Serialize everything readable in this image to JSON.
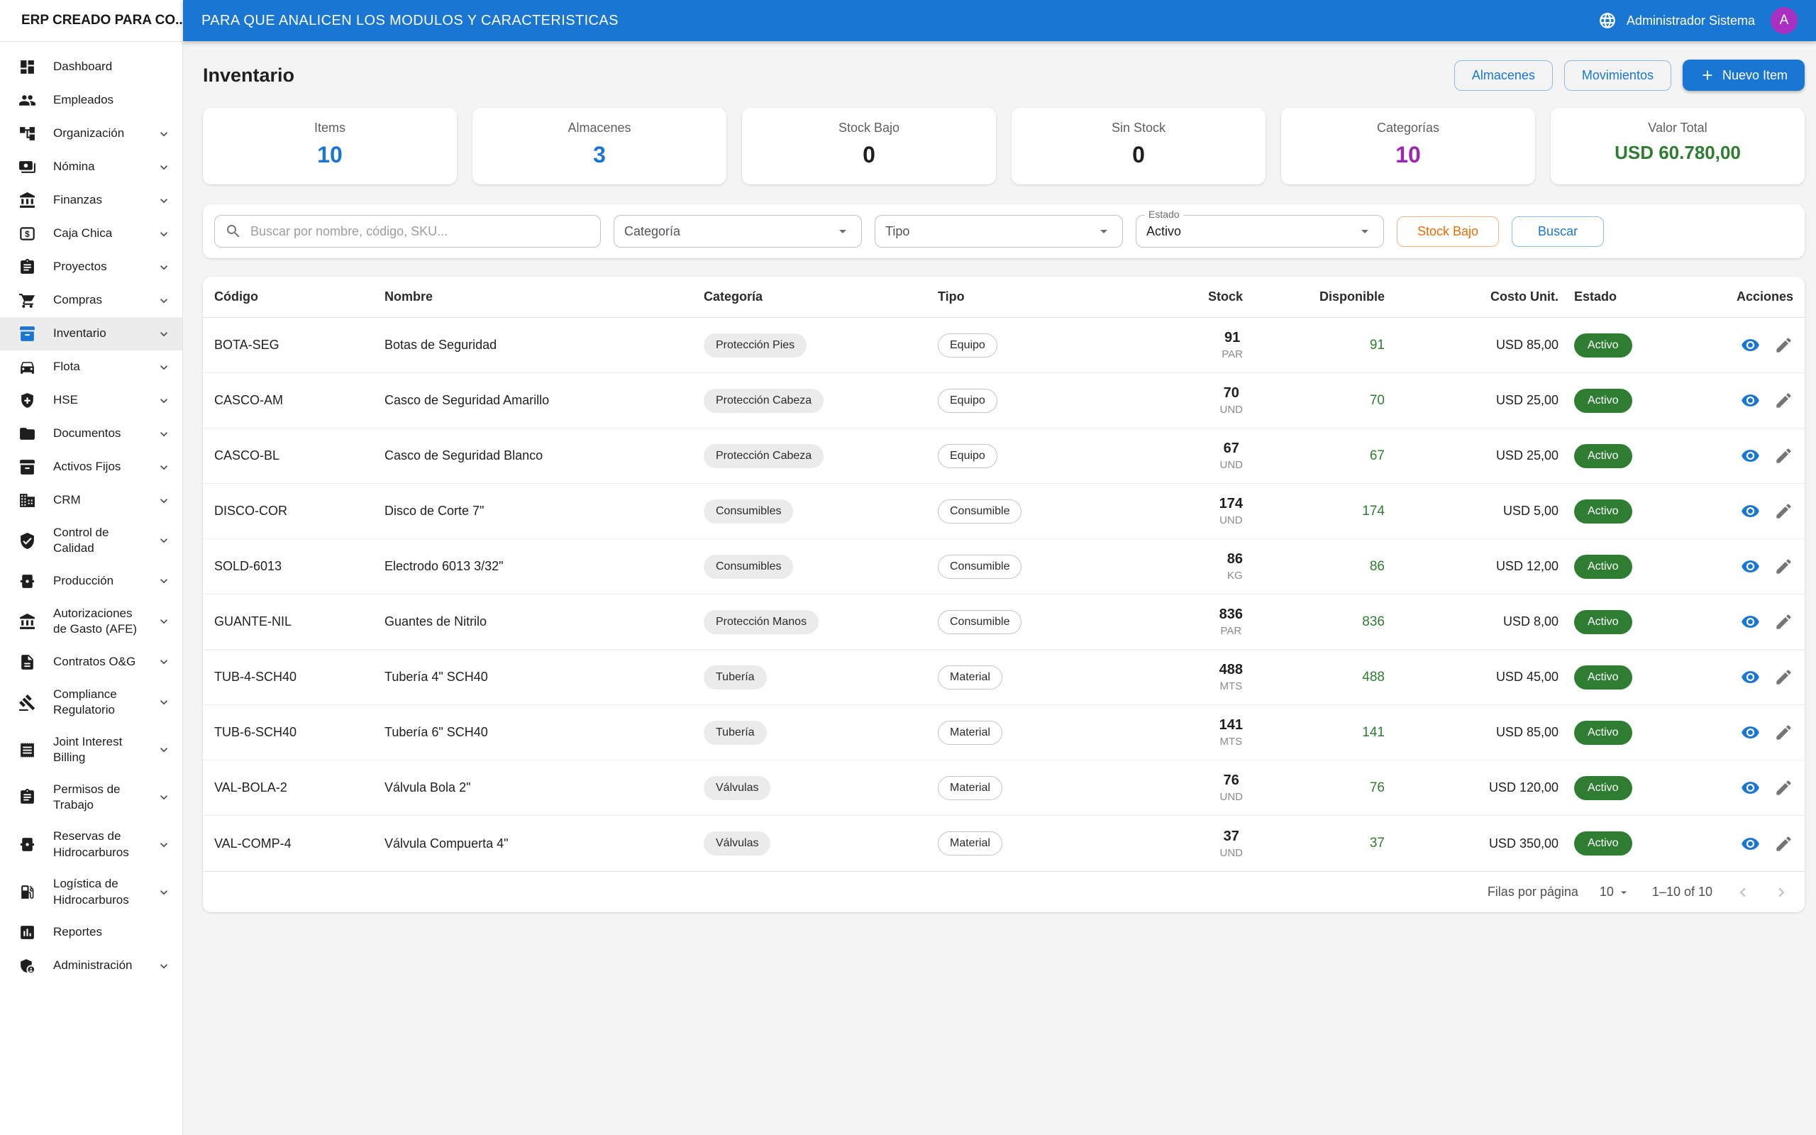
{
  "topbar": {
    "brand": "ERP CREADO PARA CO...",
    "title": "PARA QUE ANALICEN LOS MODULOS Y CARACTERISTICAS",
    "user_name": "Administrador Sistema",
    "avatar_initial": "A",
    "colors": {
      "appbar_bg": "#1976d2",
      "avatar_bg": "#a92fc1"
    }
  },
  "sidebar": {
    "items": [
      {
        "label": "Dashboard",
        "icon": "dashboard",
        "expandable": false,
        "selected": false
      },
      {
        "label": "Empleados",
        "icon": "people",
        "expandable": false,
        "selected": false
      },
      {
        "label": "Organización",
        "icon": "tree",
        "expandable": true,
        "selected": false
      },
      {
        "label": "Nómina",
        "icon": "payments",
        "expandable": true,
        "selected": false
      },
      {
        "label": "Finanzas",
        "icon": "bank",
        "expandable": true,
        "selected": false
      },
      {
        "label": "Caja Chica",
        "icon": "cashbox",
        "expandable": true,
        "selected": false
      },
      {
        "label": "Proyectos",
        "icon": "clipboard",
        "expandable": true,
        "selected": false
      },
      {
        "label": "Compras",
        "icon": "cart",
        "expandable": true,
        "selected": false
      },
      {
        "label": "Inventario",
        "icon": "inventory",
        "expandable": true,
        "selected": true
      },
      {
        "label": "Flota",
        "icon": "car",
        "expandable": true,
        "selected": false
      },
      {
        "label": "HSE",
        "icon": "shield-plus",
        "expandable": true,
        "selected": false
      },
      {
        "label": "Documentos",
        "icon": "folder",
        "expandable": true,
        "selected": false
      },
      {
        "label": "Activos Fijos",
        "icon": "inventory",
        "expandable": true,
        "selected": false
      },
      {
        "label": "CRM",
        "icon": "building",
        "expandable": true,
        "selected": false
      },
      {
        "label": "Control de Calidad",
        "icon": "shield-check",
        "expandable": true,
        "selected": false
      },
      {
        "label": "Producción",
        "icon": "barrel",
        "expandable": true,
        "selected": false
      },
      {
        "label": "Autorizaciones de Gasto (AFE)",
        "icon": "bank",
        "expandable": true,
        "selected": false
      },
      {
        "label": "Contratos O&G",
        "icon": "doc",
        "expandable": true,
        "selected": false
      },
      {
        "label": "Compliance Regulatorio",
        "icon": "gavel",
        "expandable": true,
        "selected": false
      },
      {
        "label": "Joint Interest Billing",
        "icon": "receipt",
        "expandable": true,
        "selected": false
      },
      {
        "label": "Permisos de Trabajo",
        "icon": "clipboard",
        "expandable": true,
        "selected": false
      },
      {
        "label": "Reservas de Hidrocarburos",
        "icon": "barrel",
        "expandable": true,
        "selected": false
      },
      {
        "label": "Logística de Hidrocarburos",
        "icon": "fuel",
        "expandable": true,
        "selected": false
      },
      {
        "label": "Reportes",
        "icon": "chart",
        "expandable": false,
        "selected": false
      },
      {
        "label": "Administración",
        "icon": "admin",
        "expandable": true,
        "selected": false
      }
    ]
  },
  "page": {
    "title": "Inventario",
    "almacenes_button": "Almacenes",
    "movimientos_button": "Movimientos",
    "nuevo_item_button": "Nuevo Item"
  },
  "stats": [
    {
      "label": "Items",
      "value": "10",
      "color": "#1976d2",
      "small": false
    },
    {
      "label": "Almacenes",
      "value": "3",
      "color": "#1976d2",
      "small": false
    },
    {
      "label": "Stock Bajo",
      "value": "0",
      "color": "#1f1f1f",
      "small": false
    },
    {
      "label": "Sin Stock",
      "value": "0",
      "color": "#1f1f1f",
      "small": false
    },
    {
      "label": "Categorías",
      "value": "10",
      "color": "#9c27b0",
      "small": false
    },
    {
      "label": "Valor Total",
      "value": "USD 60.780,00",
      "color": "#2e7d32",
      "small": true
    }
  ],
  "filters": {
    "search_placeholder": "Buscar por nombre, código, SKU...",
    "categoria_label": "Categoría",
    "tipo_label": "Tipo",
    "estado_label": "Estado",
    "estado_value": "Activo",
    "stock_bajo_button": "Stock Bajo",
    "buscar_button": "Buscar"
  },
  "table": {
    "headers": [
      "Código",
      "Nombre",
      "Categoría",
      "Tipo",
      "Stock",
      "Disponible",
      "Costo Unit.",
      "Estado",
      "Acciones"
    ],
    "estado_color": "#2e7d32",
    "disponible_color": "#2e7d32",
    "rows": [
      {
        "codigo": "BOTA-SEG",
        "nombre": "Botas de Seguridad",
        "categoria": "Protección Pies",
        "tipo": "Equipo",
        "stock": "91",
        "unidad": "PAR",
        "disponible": "91",
        "costo": "USD 85,00",
        "estado": "Activo"
      },
      {
        "codigo": "CASCO-AM",
        "nombre": "Casco de Seguridad Amarillo",
        "categoria": "Protección Cabeza",
        "tipo": "Equipo",
        "stock": "70",
        "unidad": "UND",
        "disponible": "70",
        "costo": "USD 25,00",
        "estado": "Activo"
      },
      {
        "codigo": "CASCO-BL",
        "nombre": "Casco de Seguridad Blanco",
        "categoria": "Protección Cabeza",
        "tipo": "Equipo",
        "stock": "67",
        "unidad": "UND",
        "disponible": "67",
        "costo": "USD 25,00",
        "estado": "Activo"
      },
      {
        "codigo": "DISCO-COR",
        "nombre": "Disco de Corte 7\"",
        "categoria": "Consumibles",
        "tipo": "Consumible",
        "stock": "174",
        "unidad": "UND",
        "disponible": "174",
        "costo": "USD 5,00",
        "estado": "Activo"
      },
      {
        "codigo": "SOLD-6013",
        "nombre": "Electrodo 6013 3/32\"",
        "categoria": "Consumibles",
        "tipo": "Consumible",
        "stock": "86",
        "unidad": "KG",
        "disponible": "86",
        "costo": "USD 12,00",
        "estado": "Activo"
      },
      {
        "codigo": "GUANTE-NIL",
        "nombre": "Guantes de Nitrilo",
        "categoria": "Protección Manos",
        "tipo": "Consumible",
        "stock": "836",
        "unidad": "PAR",
        "disponible": "836",
        "costo": "USD 8,00",
        "estado": "Activo"
      },
      {
        "codigo": "TUB-4-SCH40",
        "nombre": "Tubería 4\" SCH40",
        "categoria": "Tubería",
        "tipo": "Material",
        "stock": "488",
        "unidad": "MTS",
        "disponible": "488",
        "costo": "USD 45,00",
        "estado": "Activo"
      },
      {
        "codigo": "TUB-6-SCH40",
        "nombre": "Tubería 6\" SCH40",
        "categoria": "Tubería",
        "tipo": "Material",
        "stock": "141",
        "unidad": "MTS",
        "disponible": "141",
        "costo": "USD 85,00",
        "estado": "Activo"
      },
      {
        "codigo": "VAL-BOLA-2",
        "nombre": "Válvula Bola 2\"",
        "categoria": "Válvulas",
        "tipo": "Material",
        "stock": "76",
        "unidad": "UND",
        "disponible": "76",
        "costo": "USD 120,00",
        "estado": "Activo"
      },
      {
        "codigo": "VAL-COMP-4",
        "nombre": "Válvula Compuerta 4\"",
        "categoria": "Válvulas",
        "tipo": "Material",
        "stock": "37",
        "unidad": "UND",
        "disponible": "37",
        "costo": "USD 350,00",
        "estado": "Activo"
      }
    ]
  },
  "pagination": {
    "rows_per_page_label": "Filas por página",
    "rows_per_page_value": "10",
    "range_label": "1–10 of 10"
  }
}
